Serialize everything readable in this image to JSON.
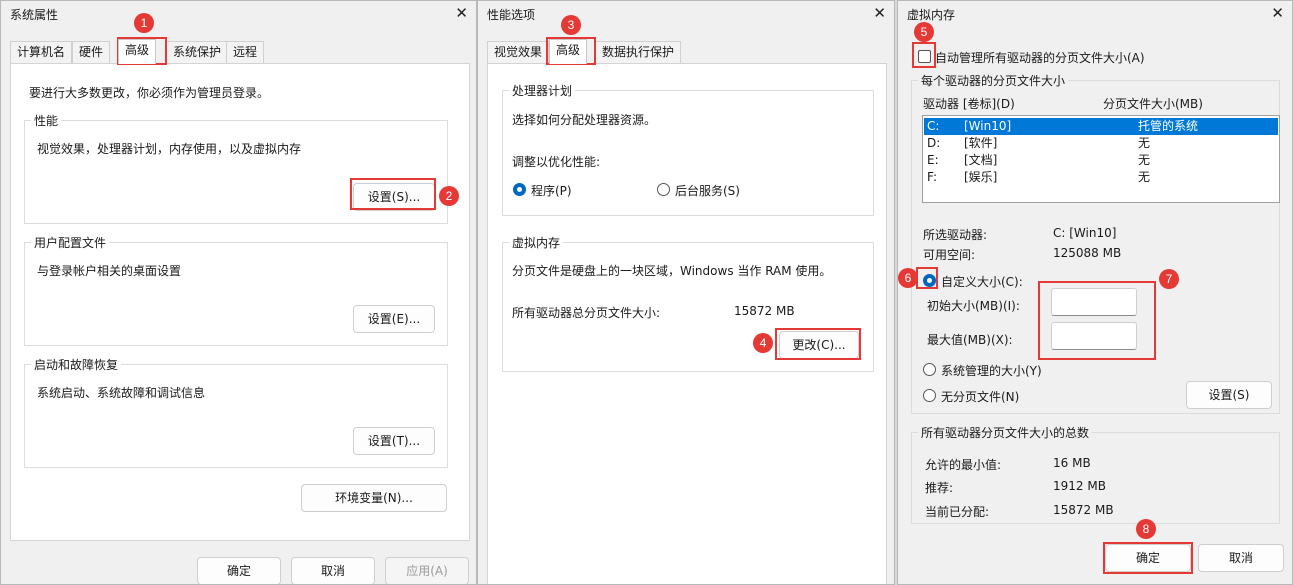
{
  "sysprops": {
    "title": "系统属性",
    "tabs": [
      "计算机名",
      "硬件",
      "高级",
      "系统保护",
      "远程"
    ],
    "admin_note": "要进行大多数更改，你必须作为管理员登录。",
    "perf_title": "性能",
    "perf_desc": "视觉效果，处理器计划，内存使用，以及虚拟内存",
    "perf_btn": "设置(S)...",
    "profile_title": "用户配置文件",
    "profile_desc": "与登录帐户相关的桌面设置",
    "profile_btn": "设置(E)...",
    "startup_title": "启动和故障恢复",
    "startup_desc": "系统启动、系统故障和调试信息",
    "startup_btn": "设置(T)...",
    "env_btn": "环境变量(N)...",
    "ok": "确定",
    "cancel": "取消",
    "apply": "应用(A)"
  },
  "perfopts": {
    "title": "性能选项",
    "tabs": [
      "视觉效果",
      "高级",
      "数据执行保护"
    ],
    "sched_title": "处理器计划",
    "sched_desc": "选择如何分配处理器资源。",
    "adjust_label": "调整以优化性能:",
    "opt_programs": "程序(P)",
    "opt_background": "后台服务(S)",
    "vm_title": "虚拟内存",
    "vm_desc": "分页文件是硬盘上的一块区域，Windows 当作 RAM 使用。",
    "total_label": "所有驱动器总分页文件大小:",
    "total_value": "15872 MB",
    "change_btn": "更改(C)..."
  },
  "vmem": {
    "title": "虚拟内存",
    "auto_manage": "自动管理所有驱动器的分页文件大小(A)",
    "per_drive_title": "每个驱动器的分页文件大小",
    "col_drive": "驱动器 [卷标](D)",
    "col_size": "分页文件大小(MB)",
    "drives": [
      {
        "letter": "C:",
        "label": "[Win10]",
        "size": "托管的系统"
      },
      {
        "letter": "D:",
        "label": "[软件]",
        "size": "无"
      },
      {
        "letter": "E:",
        "label": "[文档]",
        "size": "无"
      },
      {
        "letter": "F:",
        "label": "[娱乐]",
        "size": "无"
      }
    ],
    "selected_label": "所选驱动器:",
    "selected_value": "C:  [Win10]",
    "free_label": "可用空间:",
    "free_value": "125088 MB",
    "custom_size": "自定义大小(C):",
    "initial_label": "初始大小(MB)(I):",
    "max_label": "最大值(MB)(X):",
    "initial_value": "",
    "max_value": "",
    "system_managed": "系统管理的大小(Y)",
    "no_paging": "无分页文件(N)",
    "set_btn": "设置(S)",
    "total_title": "所有驱动器分页文件大小的总数",
    "min_label": "允许的最小值:",
    "min_value": "16 MB",
    "rec_label": "推荐:",
    "rec_value": "1912 MB",
    "alloc_label": "当前已分配:",
    "alloc_value": "15872 MB",
    "ok": "确定",
    "cancel": "取消"
  },
  "badges": [
    "1",
    "2",
    "3",
    "4",
    "5",
    "6",
    "7",
    "8"
  ],
  "icons": {
    "close": "close-icon",
    "close_glyph": "✕"
  },
  "colors": {
    "highlight": "#e53935",
    "selection": "#0078d7",
    "radio_on": "#0067c0"
  }
}
